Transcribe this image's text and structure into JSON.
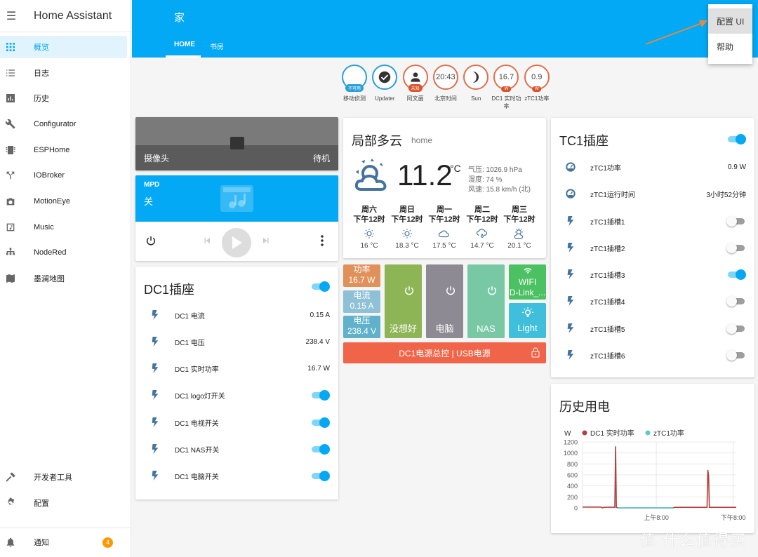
{
  "sidebar": {
    "title": "Home Assistant",
    "items": [
      {
        "label": "概览",
        "icon": "grid-icon",
        "active": true
      },
      {
        "label": "日志",
        "icon": "list-icon"
      },
      {
        "label": "历史",
        "icon": "chart-box-icon"
      },
      {
        "label": "Configurator",
        "icon": "wrench-icon"
      },
      {
        "label": "ESPHome",
        "icon": "chip-icon"
      },
      {
        "label": "IOBroker",
        "icon": "call-split-icon"
      },
      {
        "label": "MotionEye",
        "icon": "camera-icon"
      },
      {
        "label": "Music",
        "icon": "music-box-icon"
      },
      {
        "label": "NodeRed",
        "icon": "sitemap-icon"
      },
      {
        "label": "墨澜地图",
        "icon": "map-icon"
      }
    ],
    "bottom_items": [
      {
        "label": "开发者工具",
        "icon": "hammer-icon"
      },
      {
        "label": "配置",
        "icon": "gear-icon"
      }
    ],
    "notifications": {
      "label": "通知",
      "count": "4"
    }
  },
  "header": {
    "title": "家",
    "tabs": [
      {
        "label": "HOME",
        "active": true
      },
      {
        "label": "书房"
      }
    ],
    "menu": [
      {
        "label": "配置 UI",
        "highlighted": true
      },
      {
        "label": "帮助"
      }
    ],
    "accent": "#03a9f4"
  },
  "badges": [
    {
      "value": "",
      "label": "不可用",
      "name": "移动侦测",
      "color": "blue"
    },
    {
      "value": "✔",
      "label": "",
      "name": "Updater",
      "color": "blue",
      "icon": "check-circle-icon"
    },
    {
      "value": "",
      "label": "未知",
      "name": "阿文菌",
      "color": "orange",
      "icon": "account-icon"
    },
    {
      "value": "20:43",
      "label": "",
      "name": "北京时间",
      "color": "orange"
    },
    {
      "value": "",
      "label": "",
      "name": "Sun",
      "color": "orange",
      "icon": "moon-icon"
    },
    {
      "value": "16.7",
      "label": "W",
      "name": "DC1 实时功率",
      "color": "orange"
    },
    {
      "value": "0.9",
      "label": "W",
      "name": "zTC1功率",
      "color": "orange"
    }
  ],
  "camera": {
    "name": "摄像头",
    "state": "待机"
  },
  "media": {
    "source": "MPD",
    "state": "关"
  },
  "dc1": {
    "title": "DC1插座",
    "master_on": true,
    "rows": [
      {
        "name": "DC1 电流",
        "value": "0.15 A"
      },
      {
        "name": "DC1 电压",
        "value": "238.4 V"
      },
      {
        "name": "DC1 实时功率",
        "value": "16.7 W"
      },
      {
        "name": "DC1 logo灯开关",
        "toggle": true
      },
      {
        "name": "DC1 电视开关",
        "toggle": true
      },
      {
        "name": "DC1 NAS开关",
        "toggle": true
      },
      {
        "name": "DC1 电脑开关",
        "toggle": true
      }
    ]
  },
  "weather": {
    "condition": "局部多云",
    "location": "home",
    "temperature": "11.2",
    "unit": "°C",
    "pressure": "气压: 1026.9 hPa",
    "humidity": "湿度: 74 %",
    "wind": "风速: 15.8 km/h (北)",
    "forecast": [
      {
        "day": "周六",
        "time": "下午12时",
        "icon": "sunny-icon",
        "temp": "16 °C"
      },
      {
        "day": "周日",
        "time": "下午12时",
        "icon": "sunny-icon",
        "temp": "18.3 °C"
      },
      {
        "day": "周一",
        "time": "下午12时",
        "icon": "cloudy-icon",
        "temp": "17.5 °C"
      },
      {
        "day": "周二",
        "time": "下午12时",
        "icon": "rainy-icon",
        "temp": "14.7 °C"
      },
      {
        "day": "周三",
        "time": "下午12时",
        "icon": "partly-cloudy-icon",
        "temp": "20.1 °C"
      }
    ]
  },
  "tiles": {
    "power": {
      "label": "功率",
      "value": "16.7 W",
      "color": "#e0915a"
    },
    "current": {
      "label": "电流",
      "value": "0.15 A",
      "color": "#8fc1d6"
    },
    "voltage": {
      "label": "电压",
      "value": "238.4 V",
      "color": "#5fb2c9"
    },
    "switch1": {
      "label": "没想好",
      "color": "#8db555"
    },
    "switch2": {
      "label": "电脑",
      "color": "#8e8a94"
    },
    "switch3": {
      "label": "NAS",
      "color": "#79c8a5"
    },
    "wifi": {
      "label": "WIFI",
      "value": "D-Link_...",
      "color": "#4cc163"
    },
    "light": {
      "label": "Light",
      "color": "#40bfdc"
    },
    "master": {
      "label": "DC1电源总控 | USB电源",
      "color": "#f06549"
    }
  },
  "tc1": {
    "title": "TC1插座",
    "master_on": true,
    "rows": [
      {
        "name": "zTC1功率",
        "value": "0.9 W",
        "icon": "gauge-icon"
      },
      {
        "name": "zTC1运行时间",
        "value": "3小时52分钟",
        "icon": "gauge-icon"
      },
      {
        "name": "zTC1插槽1",
        "toggle": false
      },
      {
        "name": "zTC1插槽2",
        "toggle": false
      },
      {
        "name": "zTC1插槽3",
        "toggle": true
      },
      {
        "name": "zTC1插槽4",
        "toggle": false
      },
      {
        "name": "zTC1插槽5",
        "toggle": false
      },
      {
        "name": "zTC1插槽6",
        "toggle": false
      }
    ]
  },
  "history": {
    "title": "历史用电",
    "chart_data": {
      "type": "line",
      "title": "历史用电",
      "ylabel": "W",
      "xlabel": "",
      "ylim": [
        0,
        1200
      ],
      "yticks": [
        "1200",
        "1000",
        "800",
        "600",
        "400",
        "200",
        "0"
      ],
      "xticks": [
        {
          "label": "上午8:00",
          "pos": 0.48
        },
        {
          "label": "下午8:00",
          "pos": 0.98
        }
      ],
      "legend": "top-left",
      "grid": true,
      "series": [
        {
          "name": "DC1 实时功率",
          "color": "#b0413e",
          "points": [
            [
              0.0,
              15
            ],
            [
              0.12,
              15
            ],
            [
              0.13,
              0
            ],
            [
              0.14,
              12
            ],
            [
              0.21,
              12
            ],
            [
              0.215,
              1120
            ],
            [
              0.22,
              10
            ],
            [
              0.23,
              0
            ],
            [
              0.59,
              0
            ],
            [
              0.6,
              10
            ],
            [
              0.81,
              10
            ],
            [
              0.815,
              690
            ],
            [
              0.82,
              590
            ],
            [
              0.825,
              10
            ],
            [
              1.0,
              10
            ]
          ]
        },
        {
          "name": "zTC1功率",
          "color": "#5dc8cd",
          "points": [
            [
              0.23,
              1
            ],
            [
              0.59,
              1
            ]
          ]
        }
      ]
    }
  },
  "watermark": "值 什么值得买"
}
